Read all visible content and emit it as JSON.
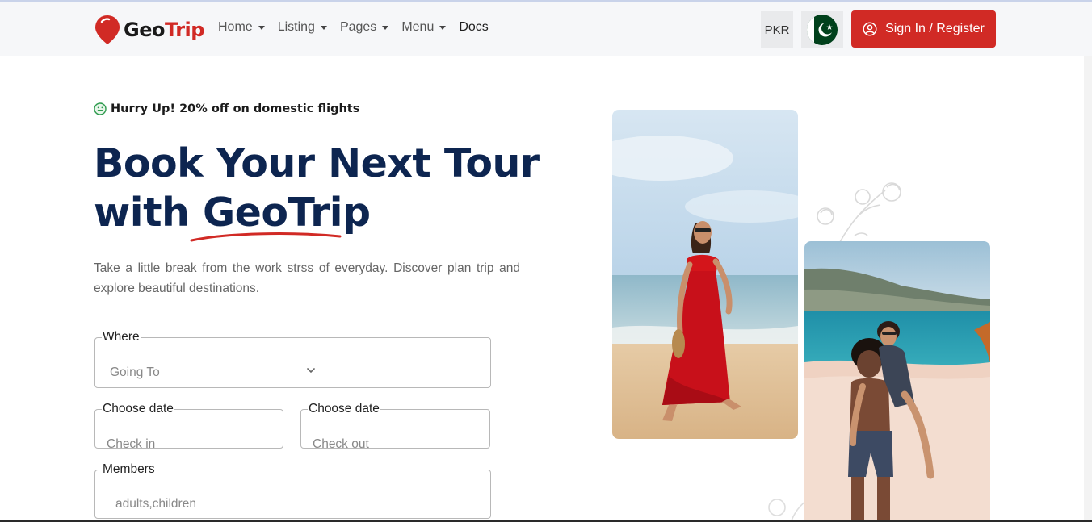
{
  "brand": {
    "part1": "Geo",
    "part2": "Trip",
    "primary_color": "#d12a25",
    "navy_color": "#0d2550"
  },
  "nav": {
    "items": [
      {
        "label": "Home",
        "has_dropdown": true
      },
      {
        "label": "Listing",
        "has_dropdown": true
      },
      {
        "label": "Pages",
        "has_dropdown": true
      },
      {
        "label": "Menu",
        "has_dropdown": true
      },
      {
        "label": "Docs",
        "has_dropdown": false
      }
    ]
  },
  "header": {
    "currency": "PKR",
    "flag_icon": "pakistan-flag-icon",
    "signin_label": "Sign In / Register",
    "signin_icon": "user-circle-icon"
  },
  "hero": {
    "promo": "Hurry Up! 20% off on domestic flights",
    "title_line1": "Book Your Next Tour",
    "title_line2_prefix": "with",
    "title_brand": "GeoTrip",
    "description": "Take a little break from the work strss of everyday. Discover plan trip and explore beautiful destinations."
  },
  "form": {
    "where": {
      "label": "Where",
      "placeholder": "Going To"
    },
    "checkin": {
      "label": "Choose date",
      "placeholder": "Check in"
    },
    "checkout": {
      "label": "Choose date",
      "placeholder": "Check out"
    },
    "members": {
      "label": "Members",
      "placeholder": "adults,children"
    }
  }
}
